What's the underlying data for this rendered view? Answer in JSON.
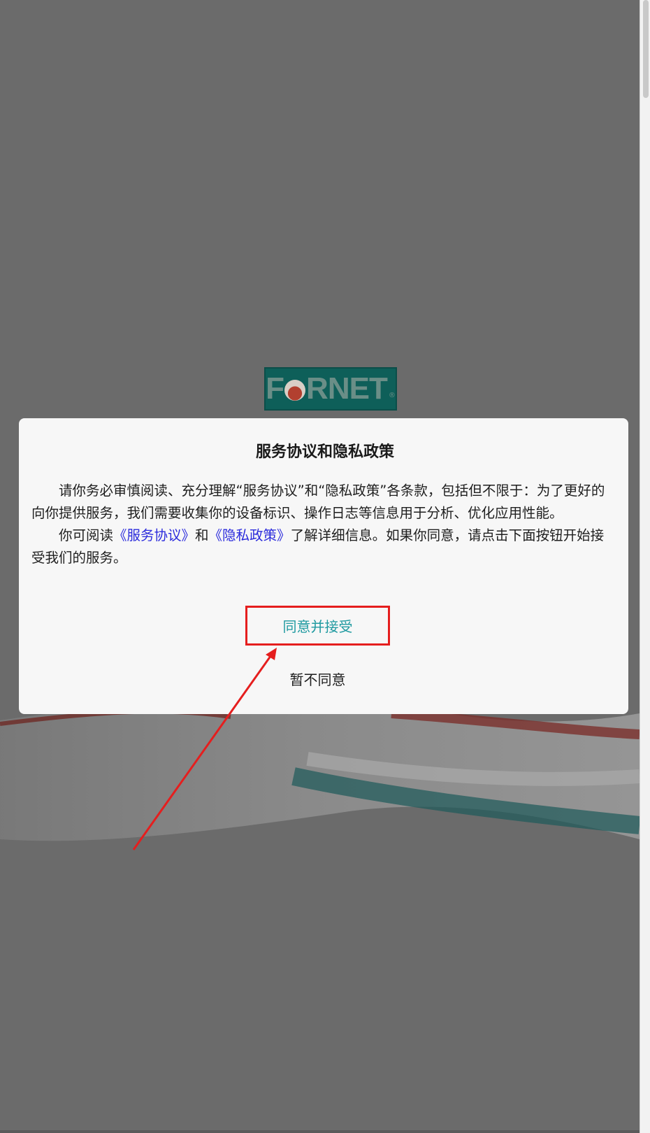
{
  "logo": {
    "text_before": "F",
    "text_after": "RNET",
    "registered": "®"
  },
  "dialog": {
    "title": "服务协议和隐私政策",
    "paragraph1": "请你务必审慎阅读、充分理解“服务协议”和“隐私政策”各条款，包括但不限于：为了更好的向你提供服务，我们需要收集你的设备标识、操作日志等信息用于分析、优化应用性能。",
    "paragraph2_prefix": "你可阅读",
    "service_link": "《服务协议》",
    "paragraph2_and": "和",
    "privacy_link": "《隐私政策》",
    "paragraph2_suffix": "了解详细信息。如果你同意，请点击下面按钮开始接受我们的服务。",
    "accept_label": "同意并接受",
    "decline_label": "暂不同意"
  },
  "colors": {
    "overlay": "#6b6b6b",
    "accent_teal": "#1f9aa0",
    "link_blue": "#2b2bdc",
    "highlight_red": "#e51e1e"
  }
}
